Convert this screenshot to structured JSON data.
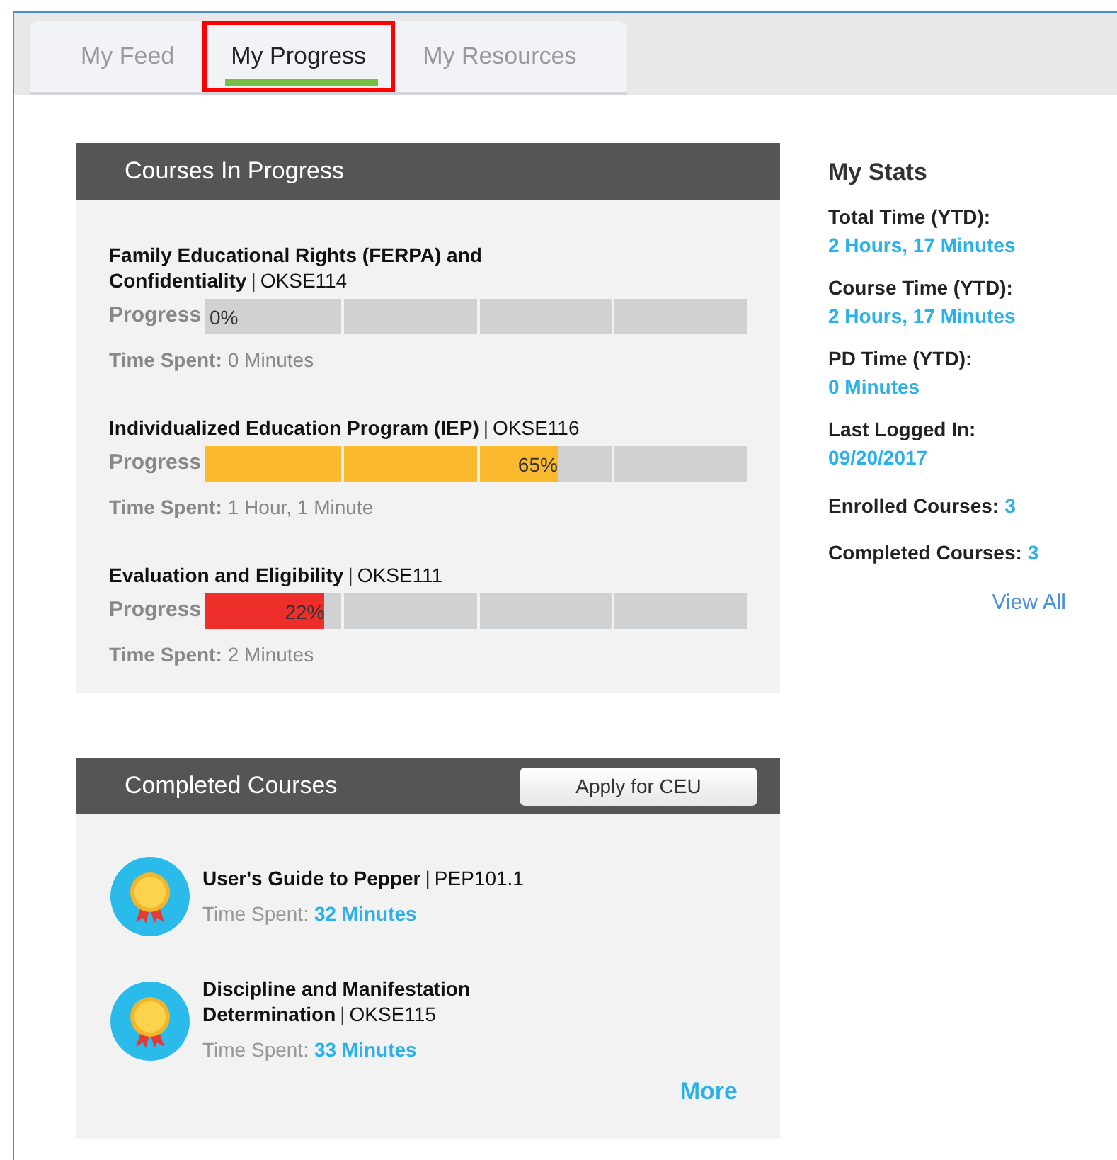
{
  "tabs": [
    {
      "label": "My Feed",
      "selected": false,
      "highlighted": false
    },
    {
      "label": "My Progress",
      "selected": true,
      "highlighted": true
    },
    {
      "label": "My Resources",
      "selected": false,
      "highlighted": false
    }
  ],
  "in_progress": {
    "title": "Courses In Progress",
    "courses": [
      {
        "title": "**Family Educational Rights (FERPA) and Confidentiality**|OKSE114",
        "progress_label": "Progress",
        "reading": "0%",
        "time_label": "Time Spent:",
        "time": "0 Minutes"
      },
      {
        "title": "**Individualized Education Program (IEP)**|OKSE116",
        "progress_label": "Progress",
        "level": 0.65,
        "color": "#fbb92e",
        "reading": "65%",
        "time_label": "Time Spent:",
        "time": "1 Hour, 1 Minute"
      },
      {
        "title": "**Evaluation and Eligibility**|OKSE111",
        "progress_label": "Progress",
        "level": 0.22,
        "color": "#ee2e2a",
        "reading": "22%",
        "time_label": "Time Spent:",
        "time": "2 Minutes"
      }
    ]
  },
  "completed": {
    "title": "Completed Courses",
    "button": "Apply for CEU",
    "courses": [
      {
        "title": "**User's Guide to Pepper**|PEP101.1",
        "time_label": "Time Spent:",
        "time": "32 Minutes"
      },
      {
        "title": "**Discipline and Manifestation Determination**|OKSE115",
        "time_label": "Time Spent:",
        "time": "33 Minutes"
      }
    ],
    "more": "More"
  },
  "stats": {
    "title": "My Stats",
    "items": [
      {
        "kind": "stacked",
        "label": "Total Time (YTD):",
        "value": "2 Hours, 17 Minutes"
      },
      {
        "kind": "stacked",
        "label": "Course Time (YTD):",
        "value": "2 Hours, 17 Minutes"
      },
      {
        "kind": "stacked",
        "label": "PD Time (YTD):",
        "value": "0 Minutes"
      },
      {
        "kind": "stacked",
        "label": "Last Logged In:",
        "value": "09/20/2017"
      },
      {
        "kind": "inline",
        "label": "Enrolled Courses:",
        "value": "3"
      },
      {
        "kind": "inline",
        "label": "Completed Courses:",
        "value": "3"
      }
    ],
    "view_all": "View All"
  }
}
